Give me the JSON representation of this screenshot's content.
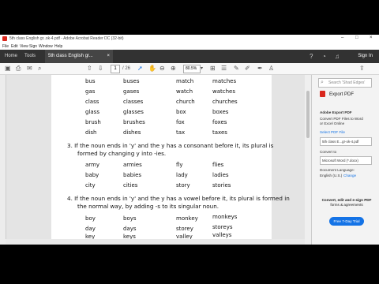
{
  "window": {
    "title": "5th class English gr..ok-4.pdf - Adobe Acrobat Reader DC (32-bit)",
    "controls": [
      "–",
      "□",
      "×"
    ]
  },
  "menu": [
    "File",
    "Edit",
    "View",
    "Sign",
    "Window",
    "Help"
  ],
  "tabs": {
    "home": "Home",
    "tools": "Tools",
    "document": "5th class English gr...",
    "close": "×"
  },
  "account": {
    "signin": "Sign In"
  },
  "toolbar": {
    "page_current": "1",
    "page_total": "/ 26",
    "zoom": "80.5%",
    "zoom_caret": "▾"
  },
  "document": {
    "table1": [
      [
        "bus",
        "buses",
        "match",
        "matches"
      ],
      [
        "gas",
        "gases",
        "watch",
        "watches"
      ],
      [
        "class",
        "classes",
        "church",
        "churches"
      ],
      [
        "glass",
        "glasses",
        "box",
        "boxes"
      ],
      [
        "brush",
        "brushes",
        "fox",
        "foxes"
      ],
      [
        "dish",
        "dishes",
        "tax",
        "taxes"
      ]
    ],
    "rule3": {
      "line1": "3.  If the noun ends in 'y' and the y has a consonant before it, its plural is",
      "line2": "formed by changing y into -ies."
    },
    "table2": [
      [
        "army",
        "armies",
        "fly",
        "flies"
      ],
      [
        "baby",
        "babies",
        "lady",
        "ladies"
      ],
      [
        "city",
        "cities",
        "story",
        "stories"
      ]
    ],
    "rule4": {
      "line1": "4.  If the noun ends in 'y' and the y has a vowel before it, its plural is formed in",
      "line2": "the normal way, by adding -s to its singular noun."
    },
    "table3": [
      [
        "boy",
        "boys",
        "monkey",
        "monkeys"
      ],
      [
        "day",
        "days",
        "storey",
        "storeys"
      ],
      [
        "key",
        "keys",
        "valley",
        "valleys"
      ]
    ]
  },
  "right_pane": {
    "search_placeholder": "Search 'Shad Edges'",
    "export_title": "Export PDF",
    "product": "Adobe Export PDF",
    "description_1": "Convert PDF Files to Word",
    "description_2": "or Excel Online",
    "select_file_label": "Select PDF File",
    "file_name": "5th class E...gr-ok-4.pdf",
    "convert_label": "Convert to",
    "format": "Microsoft Word (*.docx)",
    "language_label": "Document Language:",
    "language": "English (U.S.)",
    "change": "Change",
    "promo_1": "Convert, edit and e-sign PDF",
    "promo_2": "forms & agreements",
    "trial_button": "Free 7-Day Trial"
  },
  "colors": {
    "acrobat_red": "#d9261c",
    "tab_bar": "#323232",
    "accent_blue": "#1473e6"
  }
}
